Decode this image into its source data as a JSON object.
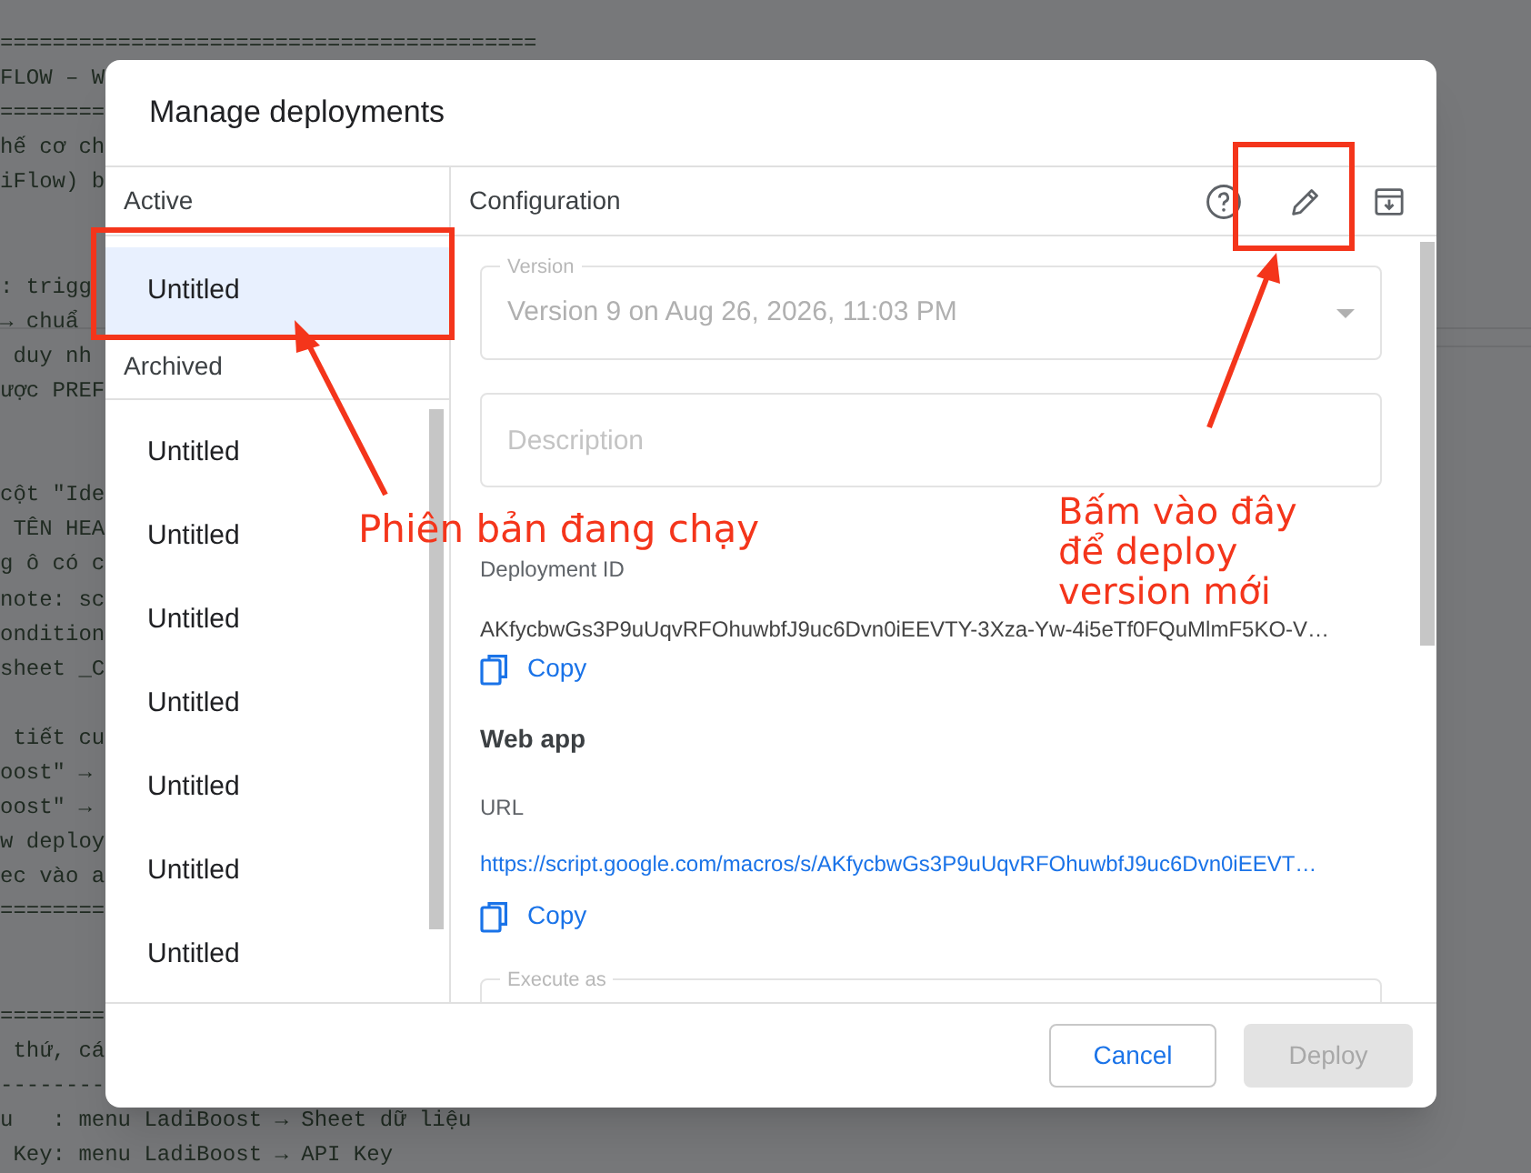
{
  "background_code": {
    "lines": [
      {
        "kind": "text",
        "text": "========================================="
      },
      {
        "kind": "text",
        "text": "FLOW – W"
      },
      {
        "kind": "text",
        "text": "========"
      },
      {
        "kind": "text",
        "text": "hế cơ ch"
      },
      {
        "kind": "text",
        "text": "iFlow) b"
      },
      {
        "kind": "blank"
      },
      {
        "kind": "blank"
      },
      {
        "kind": "text",
        "text": ": trigg"
      },
      {
        "kind": "text",
        "text": "→ chuẩ"
      },
      {
        "kind": "text",
        "text": " duy nh"
      },
      {
        "kind": "text",
        "text": "ược PREF"
      },
      {
        "kind": "blank"
      },
      {
        "kind": "blank"
      },
      {
        "kind": "text",
        "text": "cột \"Ide"
      },
      {
        "kind": "text",
        "text": " TÊN HEA"
      },
      {
        "kind": "text",
        "text": "g ô có c"
      },
      {
        "kind": "text",
        "text": "note: sc"
      },
      {
        "kind": "text",
        "text": "ondition"
      },
      {
        "kind": "text",
        "text": "sheet _C"
      },
      {
        "kind": "blank"
      },
      {
        "kind": "text",
        "text": " tiết cu"
      },
      {
        "kind": "text",
        "text": "oost\" →"
      },
      {
        "kind": "text",
        "text": "oost\" →"
      },
      {
        "kind": "text",
        "text": "w deploy"
      },
      {
        "kind": "text",
        "text": "ec vào a"
      },
      {
        "kind": "text",
        "text": "========"
      },
      {
        "kind": "blank"
      },
      {
        "kind": "blank"
      },
      {
        "kind": "text",
        "text": "========"
      },
      {
        "kind": "text",
        "text": " thứ, cá"
      },
      {
        "kind": "text",
        "text": "--------"
      },
      {
        "kind": "text",
        "text": "u   : menu LadiBoost → Sheet dữ liệu"
      },
      {
        "kind": "text",
        "text": " Key: menu LadiBoost → API Key"
      }
    ]
  },
  "dialog": {
    "title": "Manage deployments",
    "active": {
      "heading": "Active",
      "items": [
        {
          "label": "Untitled",
          "selected": true
        }
      ]
    },
    "archived": {
      "heading": "Archived",
      "items": [
        {
          "label": "Untitled",
          "selected": false
        },
        {
          "label": "Untitled",
          "selected": false
        },
        {
          "label": "Untitled",
          "selected": false
        },
        {
          "label": "Untitled",
          "selected": false
        },
        {
          "label": "Untitled",
          "selected": false
        },
        {
          "label": "Untitled",
          "selected": false
        },
        {
          "label": "Untitled",
          "selected": false
        }
      ]
    },
    "configuration": {
      "heading": "Configuration",
      "version": {
        "label": "Version",
        "value": "Version 9 on Aug 26, 2026, 11:03 PM",
        "disabled": true
      },
      "description": {
        "placeholder": "Description"
      },
      "deployment_id": {
        "label": "Deployment ID",
        "value": "AKfycbwGs3P9uUqvRFOhuwbfJ9uc6Dvn0iEEVTY-3Xza-Yw-4i5eTf0FQuMlmF5KO-V…",
        "copy": "Copy"
      },
      "web_app": {
        "heading": "Web app",
        "url_label": "URL",
        "url": "https://script.google.com/macros/s/AKfycbwGs3P9uUqvRFOhuwbfJ9uc6Dvn0iEEVT…",
        "copy": "Copy"
      },
      "execute_as": {
        "label": "Execute as"
      }
    },
    "buttons": [
      {
        "label": "Cancel",
        "disabled": false
      },
      {
        "label": "Deploy",
        "disabled": true
      }
    ]
  },
  "annotations": [
    {
      "kind": "left",
      "lines": [
        "Phiên bản đang chạy"
      ]
    },
    {
      "kind": "right",
      "lines": [
        "Bấm vào đây",
        "để deploy",
        "version mới"
      ]
    }
  ]
}
